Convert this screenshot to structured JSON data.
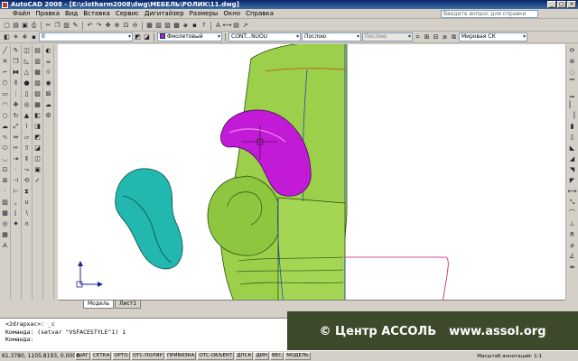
{
  "window": {
    "title": "AutoCAD 2008 - [E:\\clotharm2008\\dwg\\МЕБЕЛЬ\\РОЛИК\\11.dwg]",
    "controls": [
      "_",
      "□",
      "×"
    ]
  },
  "menu": {
    "items": [
      "Файл",
      "Правка",
      "Вид",
      "Вставка",
      "Сервис",
      "Дигитайзер",
      "Размеры",
      "Окно",
      "Справка"
    ],
    "help_placeholder": "Введите вопрос для справки"
  },
  "toolbar": {
    "color_value": "Фиолетовый",
    "linetype_value": "CONT...NUOU",
    "lineweight_value": "Послою",
    "plotstyle_value": "Послою",
    "ucs_value": "Мировая СК",
    "layer_value": "0"
  },
  "tabs": [
    {
      "label": "Модель",
      "active": true
    },
    {
      "label": "Лист1",
      "active": false
    }
  ],
  "command_line": {
    "lines": [
      "<2drapxac>: _c",
      "Команда: (setvar \"VSFACESTYLE\"1) 1",
      "Команда:"
    ]
  },
  "status": {
    "coordinates": "61.3780, 1105.8193, 0.0000",
    "buttons": [
      "ШАГ",
      "СЕТКА",
      "ОРТО",
      "ОТС-ПОЛЯР",
      "ПРИВЯЗКА",
      "ОТС-ОБЪЕКТ",
      "ДПСК",
      "ДИН",
      "ВЕС",
      "МОДЕЛЬ"
    ],
    "scale_text": "Масштаб аннотаций: 1:1"
  },
  "watermark": {
    "text1": "© Центр АССОЛЬ",
    "text2": "www.assol.org"
  },
  "colors": {
    "armrest_green": "#9ccf4a",
    "cushion_magenta": "#c21ad6",
    "roll_teal": "#22b8b0",
    "viewport_bg": "#ffffff"
  }
}
